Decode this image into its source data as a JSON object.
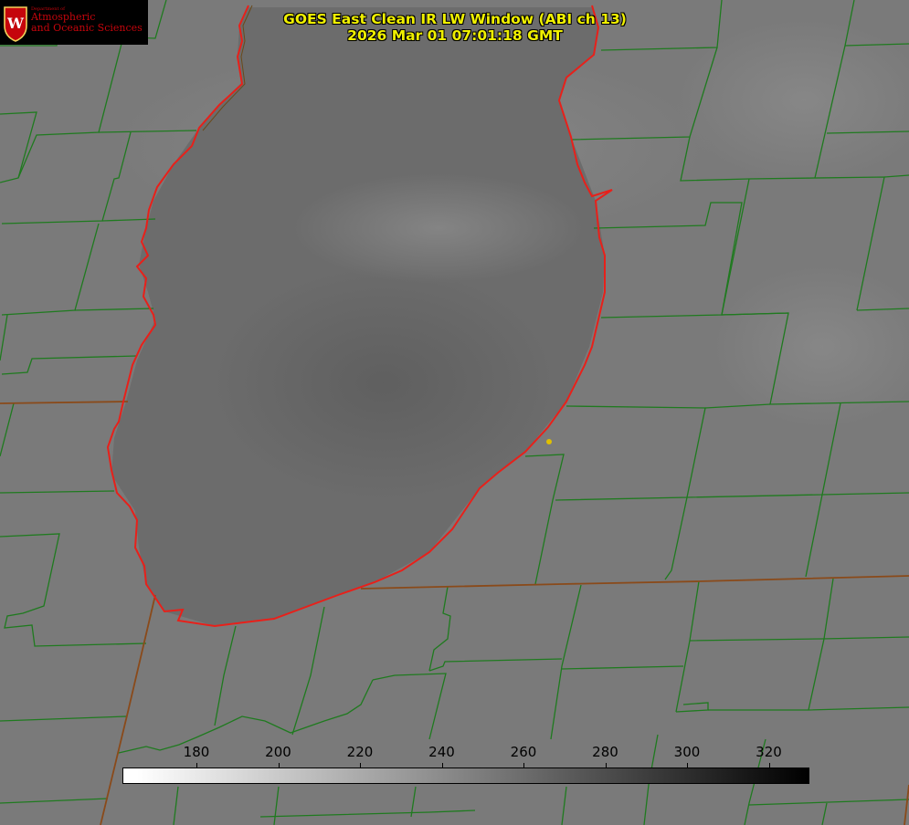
{
  "title": {
    "line1": "GOES East Clean IR LW Window (ABI ch 13)",
    "line2": "2026 Mar 01 07:01:18 GMT"
  },
  "logo": {
    "dept": "Department of",
    "line1": "Atmospheric",
    "line2": "and Oceanic Sciences",
    "icon": "uw-crest-icon",
    "color": "#c5050c"
  },
  "colorbar": {
    "ticks": [
      "180",
      "200",
      "220",
      "240",
      "260",
      "280",
      "300",
      "320"
    ],
    "gradient": [
      "#ffffff",
      "#000000"
    ]
  },
  "colors": {
    "background": "#7b7b7b",
    "lake": "#6a6a6a",
    "county_border": "#1f7a1f",
    "state_border": "#8a4a1a",
    "lake_outline": "#e8201a",
    "title": "#f0f000",
    "station_marker": "#e0c000"
  }
}
